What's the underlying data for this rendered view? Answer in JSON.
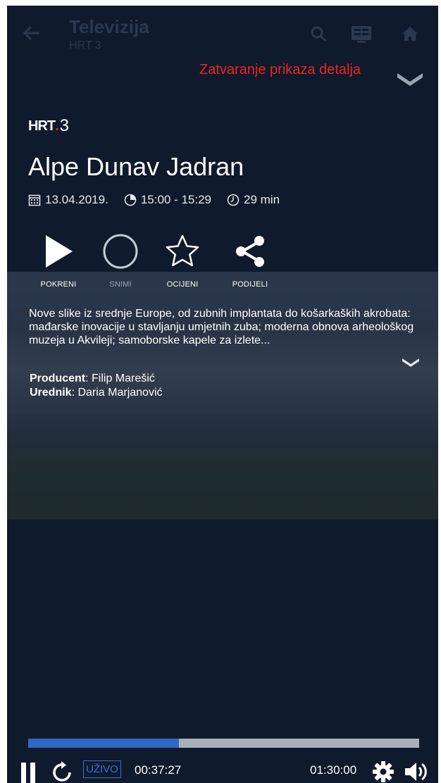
{
  "topbar": {
    "title": "Televizija",
    "subtitle": "HRT 3"
  },
  "close_details": "Zatvaranje prikaza detalja",
  "channel": {
    "logo": "HRT",
    "number": "3"
  },
  "program": {
    "title": "Alpe Dunav Jadran",
    "date": "13.04.2019.",
    "time": "15:00 - 15:29",
    "duration": "29 min"
  },
  "actions": {
    "play": "POKRENI",
    "record": "SNIMI",
    "rate": "OCIJENI",
    "share": "PODIJELI"
  },
  "description": "Nove slike iz srednje Europe, od zubnih implantata do košarkaških akrobata: mađarske inovacije u stavljanju umjetnih zuba; moderna obnova arheološkog muzeja u Akvileji; samoborske kapele za izlete...",
  "credits": {
    "producer_label": "Producent",
    "producer": ": Filip Marešić",
    "editor_label": "Urednik",
    "editor": ": Daria Marjanović"
  },
  "player": {
    "live_label": "UŽIVO",
    "current_time": "00:37:27",
    "total_time": "01:30:00",
    "progress_fraction": 0.385
  },
  "colors": {
    "background": "#0f1a2c",
    "accent_red": "#f1231e",
    "progress_fill": "#3068c8",
    "progress_track": "#aab0bb"
  }
}
